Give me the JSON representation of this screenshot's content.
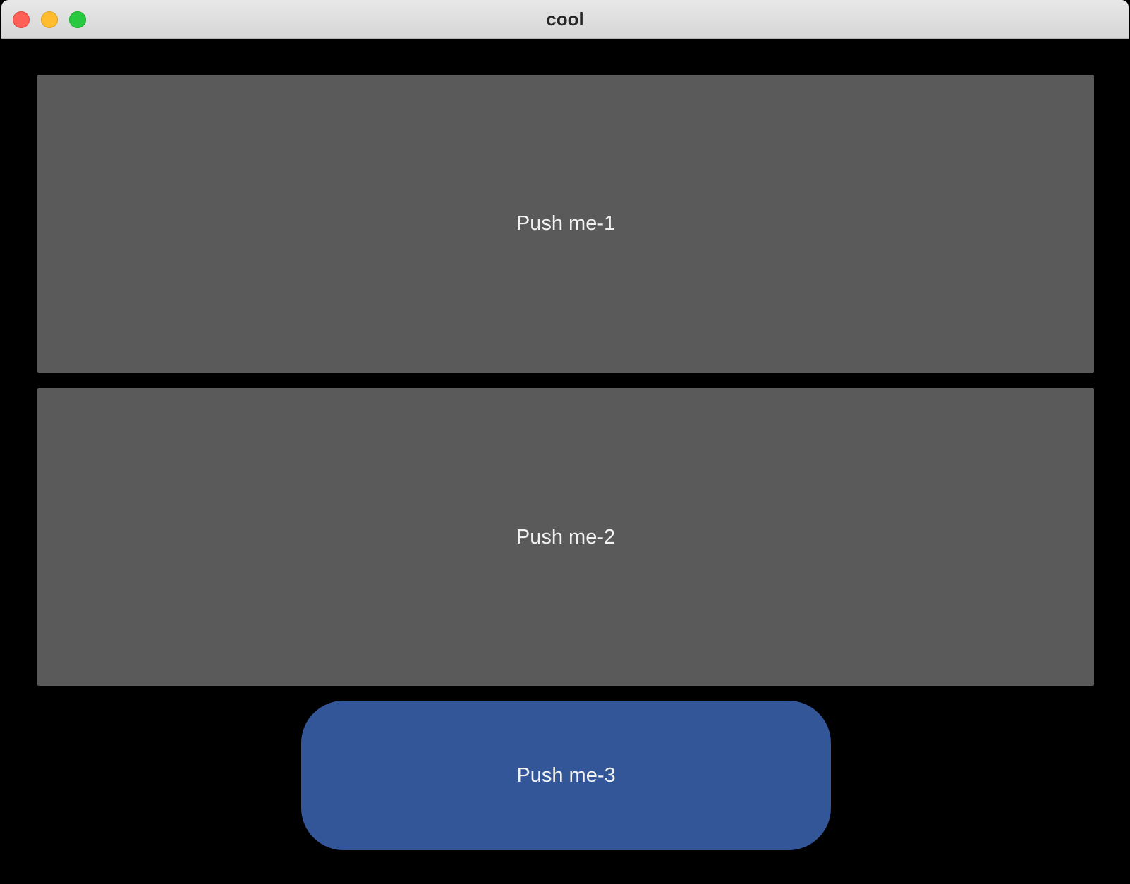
{
  "window": {
    "title": "cool"
  },
  "buttons": {
    "btn1_label": "Push me-1",
    "btn2_label": "Push me-2",
    "btn3_label": "Push me-3"
  },
  "colors": {
    "background": "#000000",
    "button_gray": "#5a5a5a",
    "button_blue": "#325698",
    "button_text": "#f2f2f2",
    "close": "#fe5f57",
    "minimize": "#febc2e",
    "maximize": "#28c840"
  }
}
